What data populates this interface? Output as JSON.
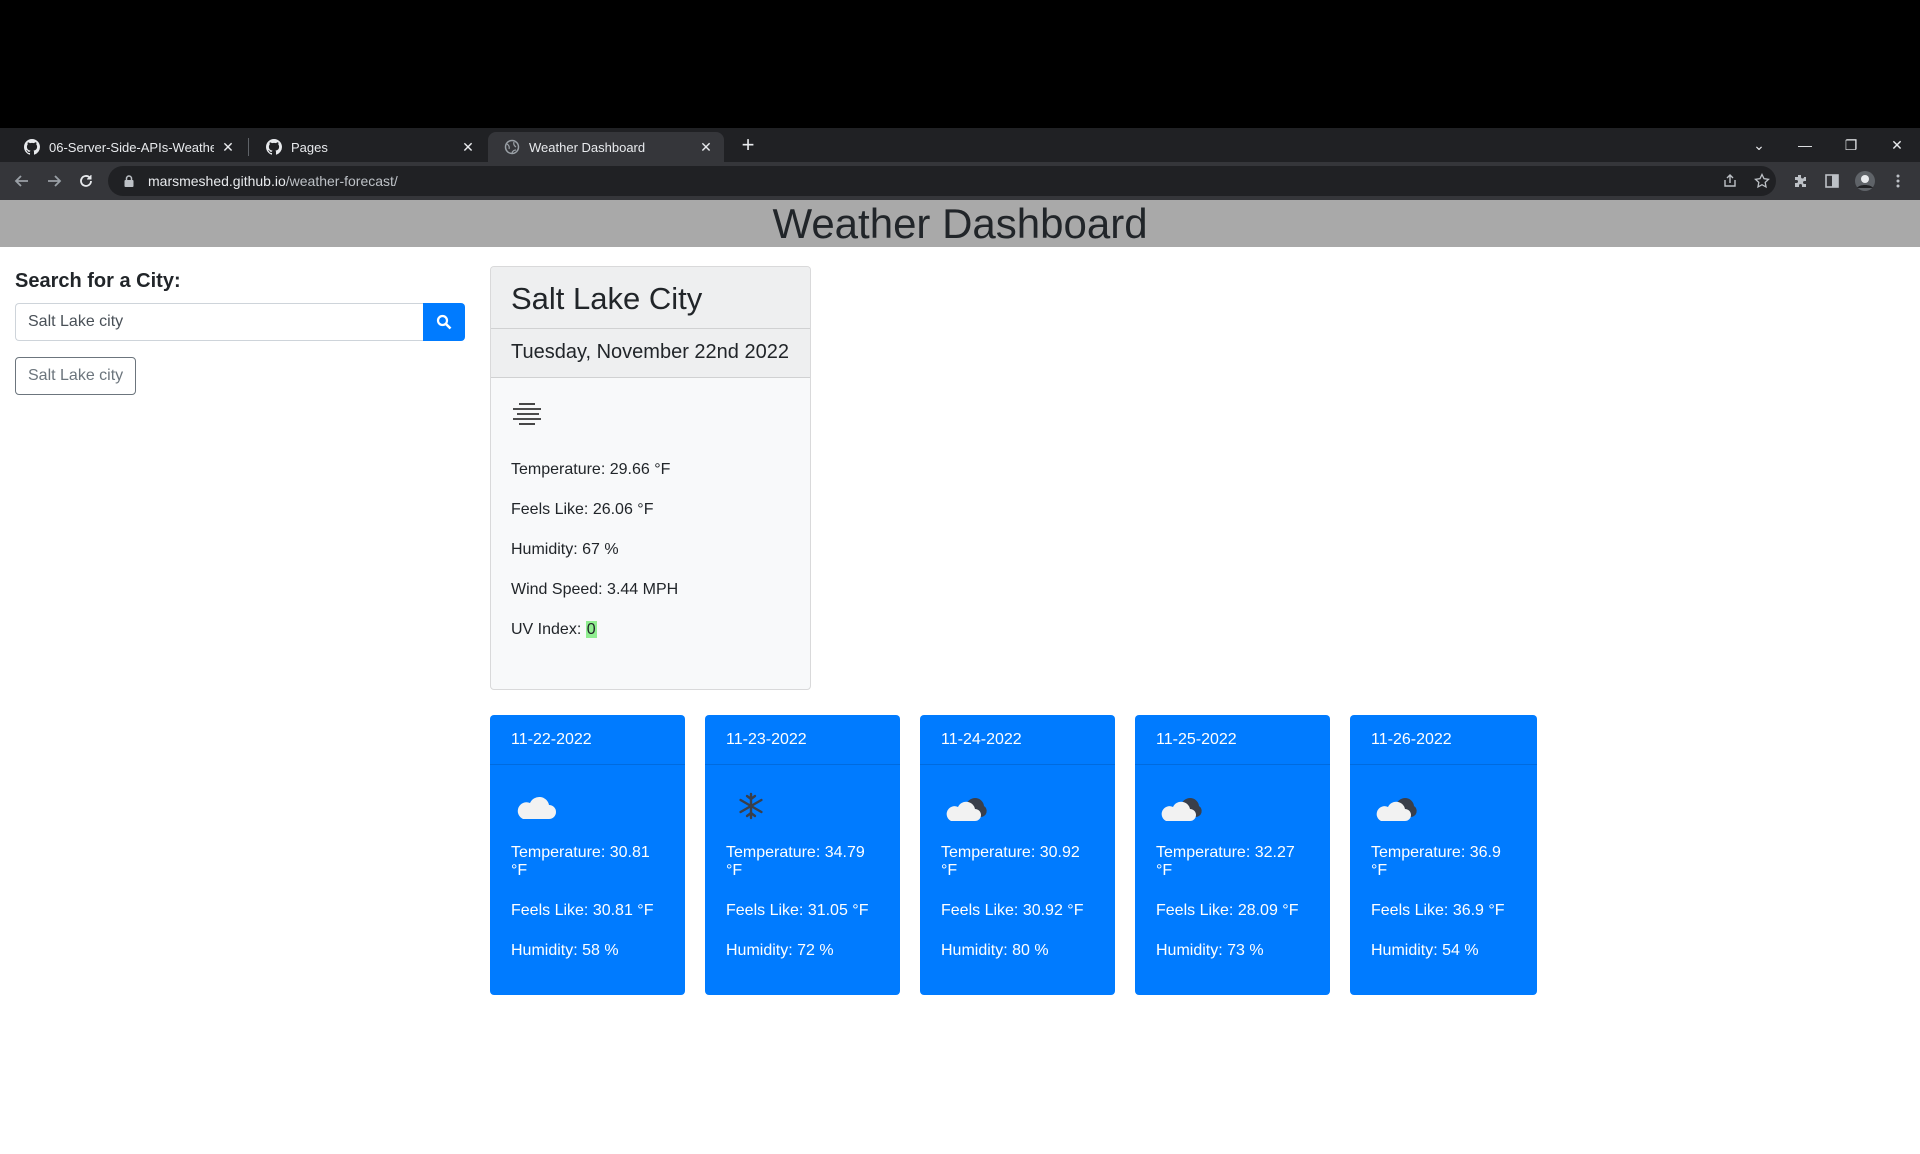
{
  "browser": {
    "tabs": [
      {
        "title": "06-Server-Side-APIs-Weather-Dashboard",
        "icon": "github-icon",
        "active": false
      },
      {
        "title": "Pages",
        "icon": "github-icon",
        "active": false
      },
      {
        "title": "Weather Dashboard",
        "icon": "globe-icon",
        "active": true
      }
    ],
    "url_host": "marsmeshed.github.io",
    "url_path": "/weather-forecast/"
  },
  "page": {
    "title": "Weather Dashboard",
    "search": {
      "heading": "Search for a City:",
      "value": "Salt Lake city",
      "button_icon": "search-icon"
    },
    "history": [
      "Salt Lake city"
    ]
  },
  "current": {
    "city": "Salt Lake City",
    "date": "Tuesday, November 22nd 2022",
    "icon": "mist-icon",
    "temperature": "Temperature: 29.66 °F",
    "feels_like": "Feels Like: 26.06 °F",
    "humidity": "Humidity: 67 %",
    "wind": "Wind Speed: 3.44 MPH",
    "uv_label": "UV Index: ",
    "uv_value": "0",
    "uv_color": "#90ee90"
  },
  "forecast": [
    {
      "date": "11-22-2022",
      "icon": "cloud-icon",
      "temperature": "Temperature: 30.81 °F",
      "feels_like": "Feels Like: 30.81 °F",
      "humidity": "Humidity: 58 %"
    },
    {
      "date": "11-23-2022",
      "icon": "snowflake-icon",
      "temperature": "Temperature: 34.79 °F",
      "feels_like": "Feels Like: 31.05 °F",
      "humidity": "Humidity: 72 %"
    },
    {
      "date": "11-24-2022",
      "icon": "broken-clouds-icon",
      "temperature": "Temperature: 30.92 °F",
      "feels_like": "Feels Like: 30.92 °F",
      "humidity": "Humidity: 80 %"
    },
    {
      "date": "11-25-2022",
      "icon": "broken-clouds-icon",
      "temperature": "Temperature: 32.27 °F",
      "feels_like": "Feels Like: 28.09 °F",
      "humidity": "Humidity: 73 %"
    },
    {
      "date": "11-26-2022",
      "icon": "broken-clouds-icon",
      "temperature": "Temperature: 36.9 °F",
      "feels_like": "Feels Like: 36.9 °F",
      "humidity": "Humidity: 54 %"
    }
  ],
  "colors": {
    "card_blue": "#007bff",
    "header_gray": "#a9a9a9"
  }
}
